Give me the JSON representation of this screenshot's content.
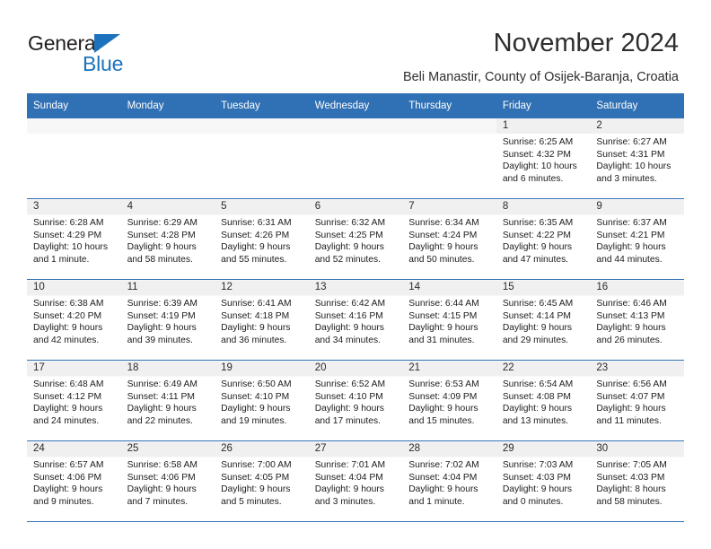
{
  "brand": {
    "name_part1": "General",
    "name_part2": "Blue",
    "triangle_color": "#1c72bc"
  },
  "header": {
    "title": "November 2024",
    "subtitle": "Beli Manastir, County of Osijek-Baranja, Croatia",
    "accent_color": "#3070b4"
  },
  "calendar": {
    "weekday_headers": [
      "Sunday",
      "Monday",
      "Tuesday",
      "Wednesday",
      "Thursday",
      "Friday",
      "Saturday"
    ],
    "weeks": [
      [
        {
          "day": "",
          "lines": []
        },
        {
          "day": "",
          "lines": []
        },
        {
          "day": "",
          "lines": []
        },
        {
          "day": "",
          "lines": []
        },
        {
          "day": "",
          "lines": []
        },
        {
          "day": "1",
          "lines": [
            "Sunrise: 6:25 AM",
            "Sunset: 4:32 PM",
            "Daylight: 10 hours",
            "and 6 minutes."
          ]
        },
        {
          "day": "2",
          "lines": [
            "Sunrise: 6:27 AM",
            "Sunset: 4:31 PM",
            "Daylight: 10 hours",
            "and 3 minutes."
          ]
        }
      ],
      [
        {
          "day": "3",
          "lines": [
            "Sunrise: 6:28 AM",
            "Sunset: 4:29 PM",
            "Daylight: 10 hours",
            "and 1 minute."
          ]
        },
        {
          "day": "4",
          "lines": [
            "Sunrise: 6:29 AM",
            "Sunset: 4:28 PM",
            "Daylight: 9 hours",
            "and 58 minutes."
          ]
        },
        {
          "day": "5",
          "lines": [
            "Sunrise: 6:31 AM",
            "Sunset: 4:26 PM",
            "Daylight: 9 hours",
            "and 55 minutes."
          ]
        },
        {
          "day": "6",
          "lines": [
            "Sunrise: 6:32 AM",
            "Sunset: 4:25 PM",
            "Daylight: 9 hours",
            "and 52 minutes."
          ]
        },
        {
          "day": "7",
          "lines": [
            "Sunrise: 6:34 AM",
            "Sunset: 4:24 PM",
            "Daylight: 9 hours",
            "and 50 minutes."
          ]
        },
        {
          "day": "8",
          "lines": [
            "Sunrise: 6:35 AM",
            "Sunset: 4:22 PM",
            "Daylight: 9 hours",
            "and 47 minutes."
          ]
        },
        {
          "day": "9",
          "lines": [
            "Sunrise: 6:37 AM",
            "Sunset: 4:21 PM",
            "Daylight: 9 hours",
            "and 44 minutes."
          ]
        }
      ],
      [
        {
          "day": "10",
          "lines": [
            "Sunrise: 6:38 AM",
            "Sunset: 4:20 PM",
            "Daylight: 9 hours",
            "and 42 minutes."
          ]
        },
        {
          "day": "11",
          "lines": [
            "Sunrise: 6:39 AM",
            "Sunset: 4:19 PM",
            "Daylight: 9 hours",
            "and 39 minutes."
          ]
        },
        {
          "day": "12",
          "lines": [
            "Sunrise: 6:41 AM",
            "Sunset: 4:18 PM",
            "Daylight: 9 hours",
            "and 36 minutes."
          ]
        },
        {
          "day": "13",
          "lines": [
            "Sunrise: 6:42 AM",
            "Sunset: 4:16 PM",
            "Daylight: 9 hours",
            "and 34 minutes."
          ]
        },
        {
          "day": "14",
          "lines": [
            "Sunrise: 6:44 AM",
            "Sunset: 4:15 PM",
            "Daylight: 9 hours",
            "and 31 minutes."
          ]
        },
        {
          "day": "15",
          "lines": [
            "Sunrise: 6:45 AM",
            "Sunset: 4:14 PM",
            "Daylight: 9 hours",
            "and 29 minutes."
          ]
        },
        {
          "day": "16",
          "lines": [
            "Sunrise: 6:46 AM",
            "Sunset: 4:13 PM",
            "Daylight: 9 hours",
            "and 26 minutes."
          ]
        }
      ],
      [
        {
          "day": "17",
          "lines": [
            "Sunrise: 6:48 AM",
            "Sunset: 4:12 PM",
            "Daylight: 9 hours",
            "and 24 minutes."
          ]
        },
        {
          "day": "18",
          "lines": [
            "Sunrise: 6:49 AM",
            "Sunset: 4:11 PM",
            "Daylight: 9 hours",
            "and 22 minutes."
          ]
        },
        {
          "day": "19",
          "lines": [
            "Sunrise: 6:50 AM",
            "Sunset: 4:10 PM",
            "Daylight: 9 hours",
            "and 19 minutes."
          ]
        },
        {
          "day": "20",
          "lines": [
            "Sunrise: 6:52 AM",
            "Sunset: 4:10 PM",
            "Daylight: 9 hours",
            "and 17 minutes."
          ]
        },
        {
          "day": "21",
          "lines": [
            "Sunrise: 6:53 AM",
            "Sunset: 4:09 PM",
            "Daylight: 9 hours",
            "and 15 minutes."
          ]
        },
        {
          "day": "22",
          "lines": [
            "Sunrise: 6:54 AM",
            "Sunset: 4:08 PM",
            "Daylight: 9 hours",
            "and 13 minutes."
          ]
        },
        {
          "day": "23",
          "lines": [
            "Sunrise: 6:56 AM",
            "Sunset: 4:07 PM",
            "Daylight: 9 hours",
            "and 11 minutes."
          ]
        }
      ],
      [
        {
          "day": "24",
          "lines": [
            "Sunrise: 6:57 AM",
            "Sunset: 4:06 PM",
            "Daylight: 9 hours",
            "and 9 minutes."
          ]
        },
        {
          "day": "25",
          "lines": [
            "Sunrise: 6:58 AM",
            "Sunset: 4:06 PM",
            "Daylight: 9 hours",
            "and 7 minutes."
          ]
        },
        {
          "day": "26",
          "lines": [
            "Sunrise: 7:00 AM",
            "Sunset: 4:05 PM",
            "Daylight: 9 hours",
            "and 5 minutes."
          ]
        },
        {
          "day": "27",
          "lines": [
            "Sunrise: 7:01 AM",
            "Sunset: 4:04 PM",
            "Daylight: 9 hours",
            "and 3 minutes."
          ]
        },
        {
          "day": "28",
          "lines": [
            "Sunrise: 7:02 AM",
            "Sunset: 4:04 PM",
            "Daylight: 9 hours",
            "and 1 minute."
          ]
        },
        {
          "day": "29",
          "lines": [
            "Sunrise: 7:03 AM",
            "Sunset: 4:03 PM",
            "Daylight: 9 hours",
            "and 0 minutes."
          ]
        },
        {
          "day": "30",
          "lines": [
            "Sunrise: 7:05 AM",
            "Sunset: 4:03 PM",
            "Daylight: 8 hours",
            "and 58 minutes."
          ]
        }
      ]
    ]
  }
}
